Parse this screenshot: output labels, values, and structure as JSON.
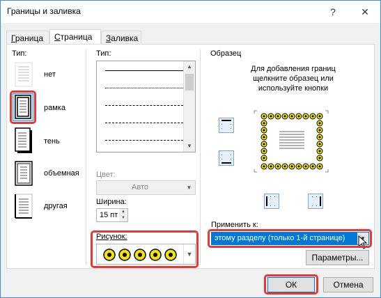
{
  "window": {
    "title": "Границы и заливка",
    "help_glyph": "?",
    "close_glyph": "✕"
  },
  "tabs": [
    {
      "label": "Граница",
      "underline": "Г",
      "rest": "раница"
    },
    {
      "label": "Страница",
      "underline": "С",
      "rest": "траница"
    },
    {
      "label": "Заливка",
      "underline": "З",
      "rest": "аливка"
    }
  ],
  "setting": {
    "label": "Тип:",
    "items": [
      {
        "label": "нет",
        "icon": "no-border-icon"
      },
      {
        "label": "рамка",
        "icon": "box-border-icon",
        "selected": true
      },
      {
        "label": "тень",
        "icon": "shadow-border-icon"
      },
      {
        "label": "объемная",
        "icon": "3d-border-icon"
      },
      {
        "label": "другая",
        "icon": "custom-border-icon"
      }
    ]
  },
  "style": {
    "label": "Тип:"
  },
  "color": {
    "label": "Цвет:",
    "value": "Авто"
  },
  "width": {
    "label": "Ширина:",
    "value": "15 пт"
  },
  "art": {
    "label": "Рисунок:"
  },
  "preview": {
    "label": "Образец",
    "hint_line1": "Для добавления границ",
    "hint_line2": "щелкните образец или",
    "hint_line3": "используйте кнопки"
  },
  "apply": {
    "label": "Применить к:",
    "value": "этому разделу (только 1-й странице)"
  },
  "buttons": {
    "options": "Параметры...",
    "ok": "ОК",
    "cancel": "Отмена"
  },
  "colors": {
    "accent": "#0078d7",
    "highlight": "#e53935"
  }
}
